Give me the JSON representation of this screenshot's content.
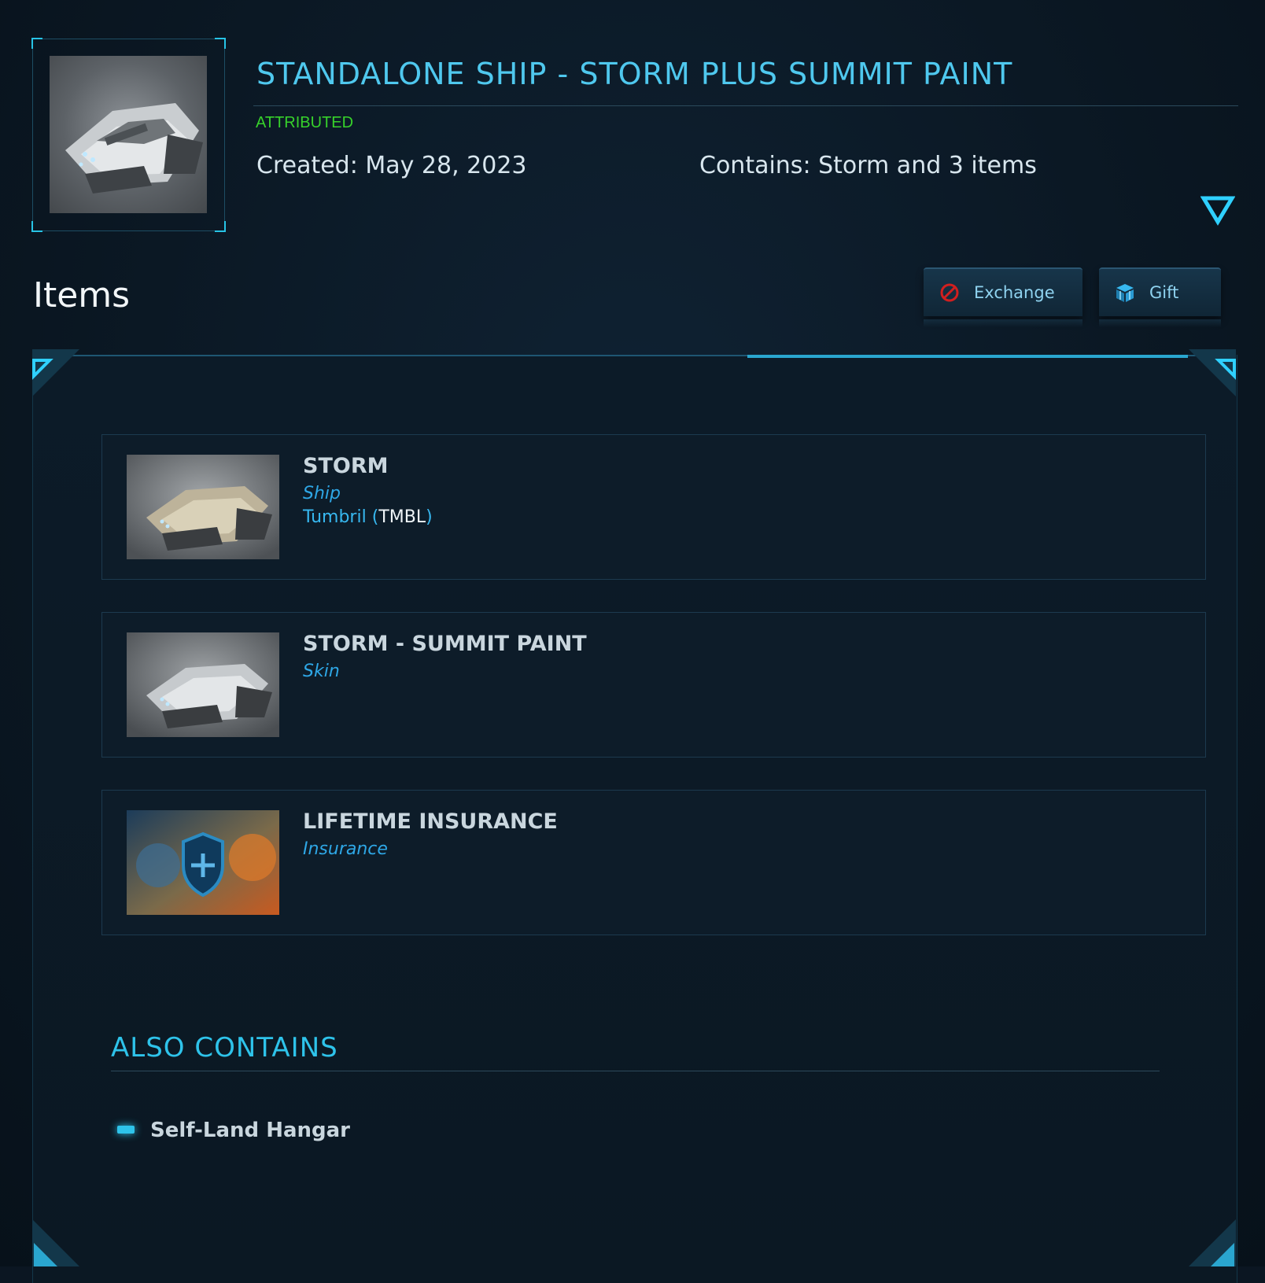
{
  "pledge": {
    "title": "STANDALONE SHIP - STORM PLUS SUMMIT PAINT",
    "status": "ATTRIBUTED",
    "created": "Created: May 28, 2023",
    "contains": "Contains: Storm and 3 items"
  },
  "items_section": {
    "heading": "Items",
    "exchange_label": "Exchange",
    "gift_label": "Gift"
  },
  "items": [
    {
      "name": "STORM",
      "type": "Ship",
      "maker": "Tumbril",
      "maker_code": "TMBL"
    },
    {
      "name": "STORM - SUMMIT PAINT",
      "type": "Skin"
    },
    {
      "name": "LIFETIME INSURANCE",
      "type": "Insurance"
    }
  ],
  "also_contains": {
    "title": "ALSO CONTAINS",
    "items": [
      "Self-Land Hangar"
    ]
  },
  "colors": {
    "accent": "#2ec3ea",
    "status_green": "#37d12b",
    "exchange_icon_red": "#d11f1f"
  },
  "icons": {
    "exchange": "no-entry-icon",
    "gift": "gift-box-icon",
    "expand": "triangle-down-icon"
  }
}
